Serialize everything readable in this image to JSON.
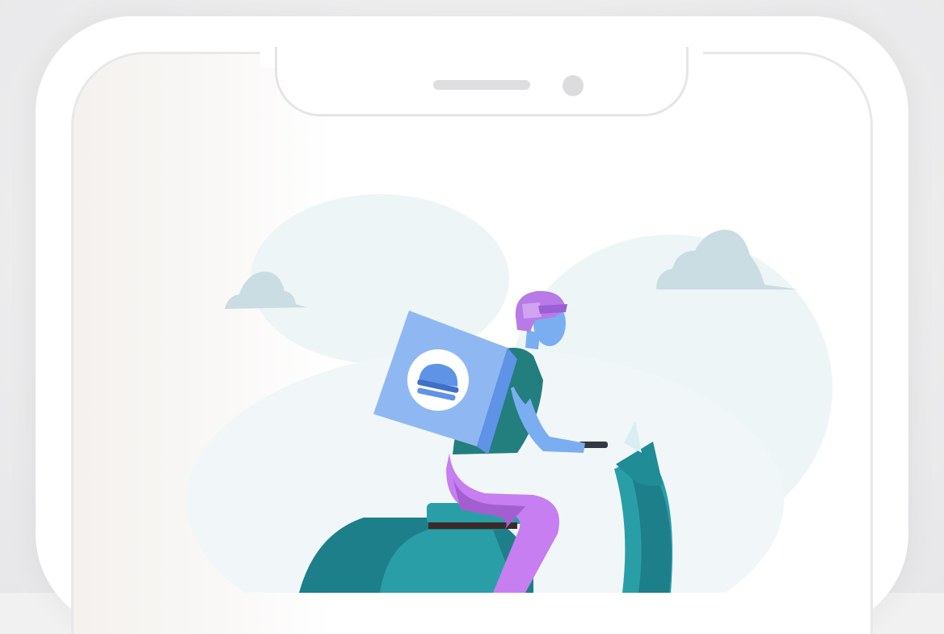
{
  "scene": {
    "subject": "delivery-rider-on-scooter",
    "icons": [
      "smartphone-frame",
      "delivery-box-icon",
      "burger-icon",
      "cloud-icon"
    ]
  },
  "colors": {
    "page_background": "#f1f1f2",
    "phone_frame": "#ffffff",
    "screen_tint": "#f0f6f8",
    "cloud": "#c9dde2",
    "teal": "#2a9ea7",
    "teal_dark": "#1d7f89",
    "teal_shirt": "#237e7e",
    "helmet": "#b87ae6",
    "pants": "#c67ef0",
    "skin": "#7aaef0",
    "box": "#8fb8f3",
    "box_dark": "#5f93e6"
  }
}
